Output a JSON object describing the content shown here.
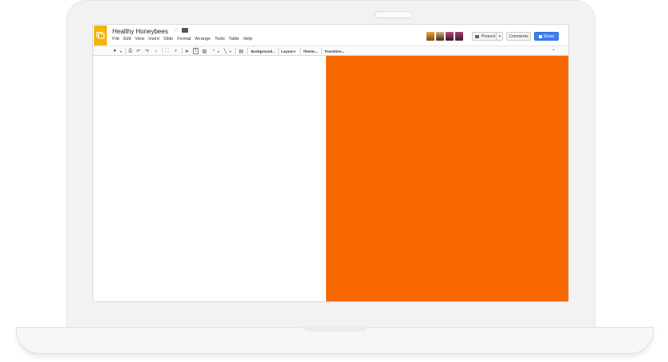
{
  "document": {
    "title": "Healthy Honeybees"
  },
  "menu": {
    "items": [
      "File",
      "Edit",
      "View",
      "Insert",
      "Slide",
      "Format",
      "Arrange",
      "Tools",
      "Table",
      "Help"
    ]
  },
  "header": {
    "present_label": "Present",
    "comments_label": "Comments",
    "share_label": "Share"
  },
  "toolbar": {
    "background_label": "Background...",
    "layout_label": "Layout",
    "theme_label": "Theme...",
    "transition_label": "Transition..."
  },
  "colors": {
    "app_accent": "#f4b400",
    "share_blue": "#3d7ff0",
    "slide_orange": "#f76800"
  },
  "icons": [
    "slides-logo-icon",
    "star-icon",
    "folder-icon",
    "present-icon",
    "share-lock-icon",
    "collapse-icon"
  ]
}
